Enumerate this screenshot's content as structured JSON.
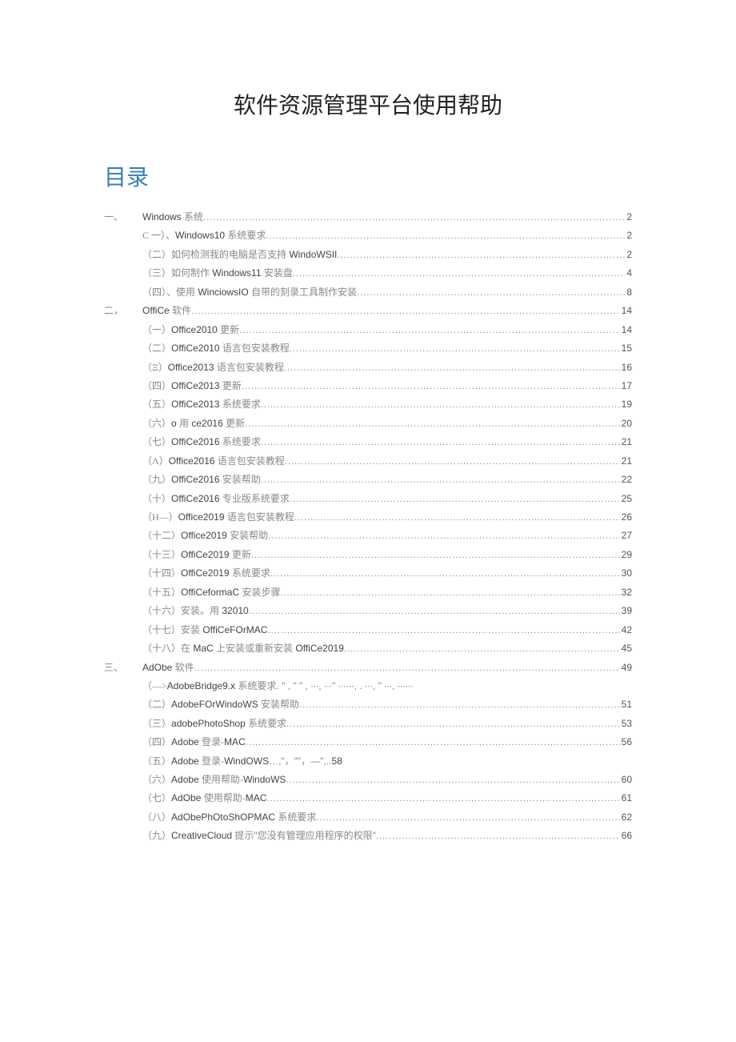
{
  "title": "软件资源管理平台使用帮助",
  "toc_heading": "目录",
  "toc": [
    {
      "level": 1,
      "prefix": "一、",
      "text": "Windows 系统",
      "page": "2"
    },
    {
      "level": 2,
      "prefix": "C 一）、",
      "text": "Windows10 系统要求",
      "page": "2"
    },
    {
      "level": 2,
      "prefix": "（二）",
      "text": "如何检测我的电脑是否支持 WindoWSII",
      "page": "2"
    },
    {
      "level": 2,
      "prefix": "（三）",
      "text": "如何制作 Windows11 安装盘",
      "page": "4"
    },
    {
      "level": 2,
      "prefix": "（四）、",
      "text": "使用 WinciowsIO 自带的刻录工具制作安装",
      "page": "8"
    },
    {
      "level": 1,
      "prefix": "二，",
      "text": "OffiCe 软件",
      "page": "14"
    },
    {
      "level": 2,
      "prefix": "（一）",
      "text": "Office2010 更新",
      "page": "14"
    },
    {
      "level": 2,
      "prefix": "（二）",
      "text": "OffiCe2010 语言包安装教程",
      "page": "15"
    },
    {
      "level": 2,
      "prefix": "（Ξ）",
      "text": "Office2013 语言包安装教程",
      "page": "16"
    },
    {
      "level": 2,
      "prefix": "（四）",
      "text": "OffiCe2013 更新",
      "page": "17"
    },
    {
      "level": 2,
      "prefix": "（五）",
      "text": "OffiCe2013 系统要求",
      "page": "19"
    },
    {
      "level": 2,
      "prefix": "（六）",
      "text": "o 用 ce2016 更新",
      "page": "20"
    },
    {
      "level": 2,
      "prefix": "（七）",
      "text": "OffiCe2016 系统要求",
      "page": "21"
    },
    {
      "level": 2,
      "prefix": "（Λ）",
      "text": "Office2016 语言包安装教程",
      "page": "21"
    },
    {
      "level": 2,
      "prefix": "（九）",
      "text": "OffiCe2016 安装帮助",
      "page": "22"
    },
    {
      "level": 2,
      "prefix": "（十）",
      "text": "OffiCe2016 专业版系统要求",
      "page": "25"
    },
    {
      "level": 2,
      "prefix": "（H—）",
      "text": "Office2019 语言包安装教程",
      "page": "26"
    },
    {
      "level": 2,
      "prefix": "（十二）",
      "text": "Office2019 安装帮助",
      "page": "27"
    },
    {
      "level": 2,
      "prefix": "（十三）",
      "text": "OffiCe2019 更新",
      "page": "29"
    },
    {
      "level": 2,
      "prefix": "（十四）",
      "text": "OffiCe2019 系统要求",
      "page": "30"
    },
    {
      "level": 2,
      "prefix": "（十五）",
      "text": "OffiCeformaC 安装步骤",
      "page": "32"
    },
    {
      "level": 2,
      "prefix": "（十六）",
      "text": "安装。用 32010",
      "page": "39"
    },
    {
      "level": 2,
      "prefix": "（十七）",
      "text": "安装 OffiCeFOrMAC",
      "page": "42"
    },
    {
      "level": 2,
      "prefix": "（十八）",
      "text": "在 MaC 上安装或重新安装 OffiCe2019",
      "page": "45"
    },
    {
      "level": 1,
      "prefix": "三、",
      "text": "AdObe 软件",
      "page": "49"
    },
    {
      "level": 2,
      "prefix": "（—>",
      "text": "AdobeBridge9.x 系统要求. \" , \" \" , ∙∙∙, ∙∙∙\" ∙∙∙∙∙∙, . ∙∙∙, \" ∙∙∙, ∙∙∙∙∙∙",
      "page": "",
      "no_leader": true
    },
    {
      "level": 2,
      "prefix": "（二）",
      "text": "AdobeFOrWindoWS 安装帮助",
      "page": "51"
    },
    {
      "level": 2,
      "prefix": "（三）",
      "text": "adobePhotoShop 系统要求",
      "page": "53"
    },
    {
      "level": 2,
      "prefix": "（四）",
      "text": "Adobe 登录-MAC",
      "page": "56"
    },
    {
      "level": 2,
      "prefix": "（五）",
      "text": "Adobe 登录-WindOWS…,\"，\"\"，—\",..58",
      "page": "",
      "no_leader": true
    },
    {
      "level": 2,
      "prefix": "（六）",
      "text": "Adobe 使用帮助-WindoWS",
      "page": "60"
    },
    {
      "level": 2,
      "prefix": "（七）",
      "text": "AdObe 使用帮助-MAC",
      "page": "61"
    },
    {
      "level": 2,
      "prefix": "（八）",
      "text": "AdObePhOtoShOPMAC 系统要求",
      "page": "62"
    },
    {
      "level": 2,
      "prefix": "（九）",
      "text": "CreativeCloud 提示\"您没有管理应用程序的权限\"",
      "page": "66"
    }
  ]
}
